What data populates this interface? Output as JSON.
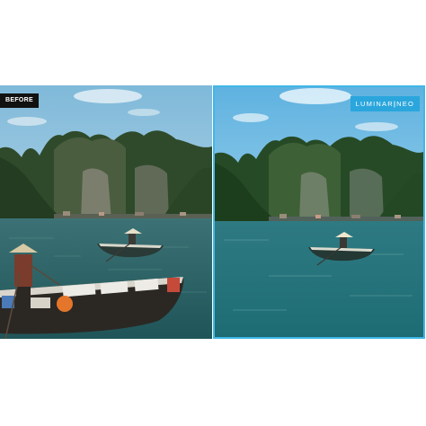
{
  "before_label": "BEFORE",
  "after_brand": {
    "primary": "LUMINAR",
    "separator": "|",
    "secondary": "NEO"
  },
  "colors": {
    "accent_border": "#3fb7e6",
    "brand_badge_bg": "#2aa6dd",
    "before_badge_bg": "#111111"
  }
}
